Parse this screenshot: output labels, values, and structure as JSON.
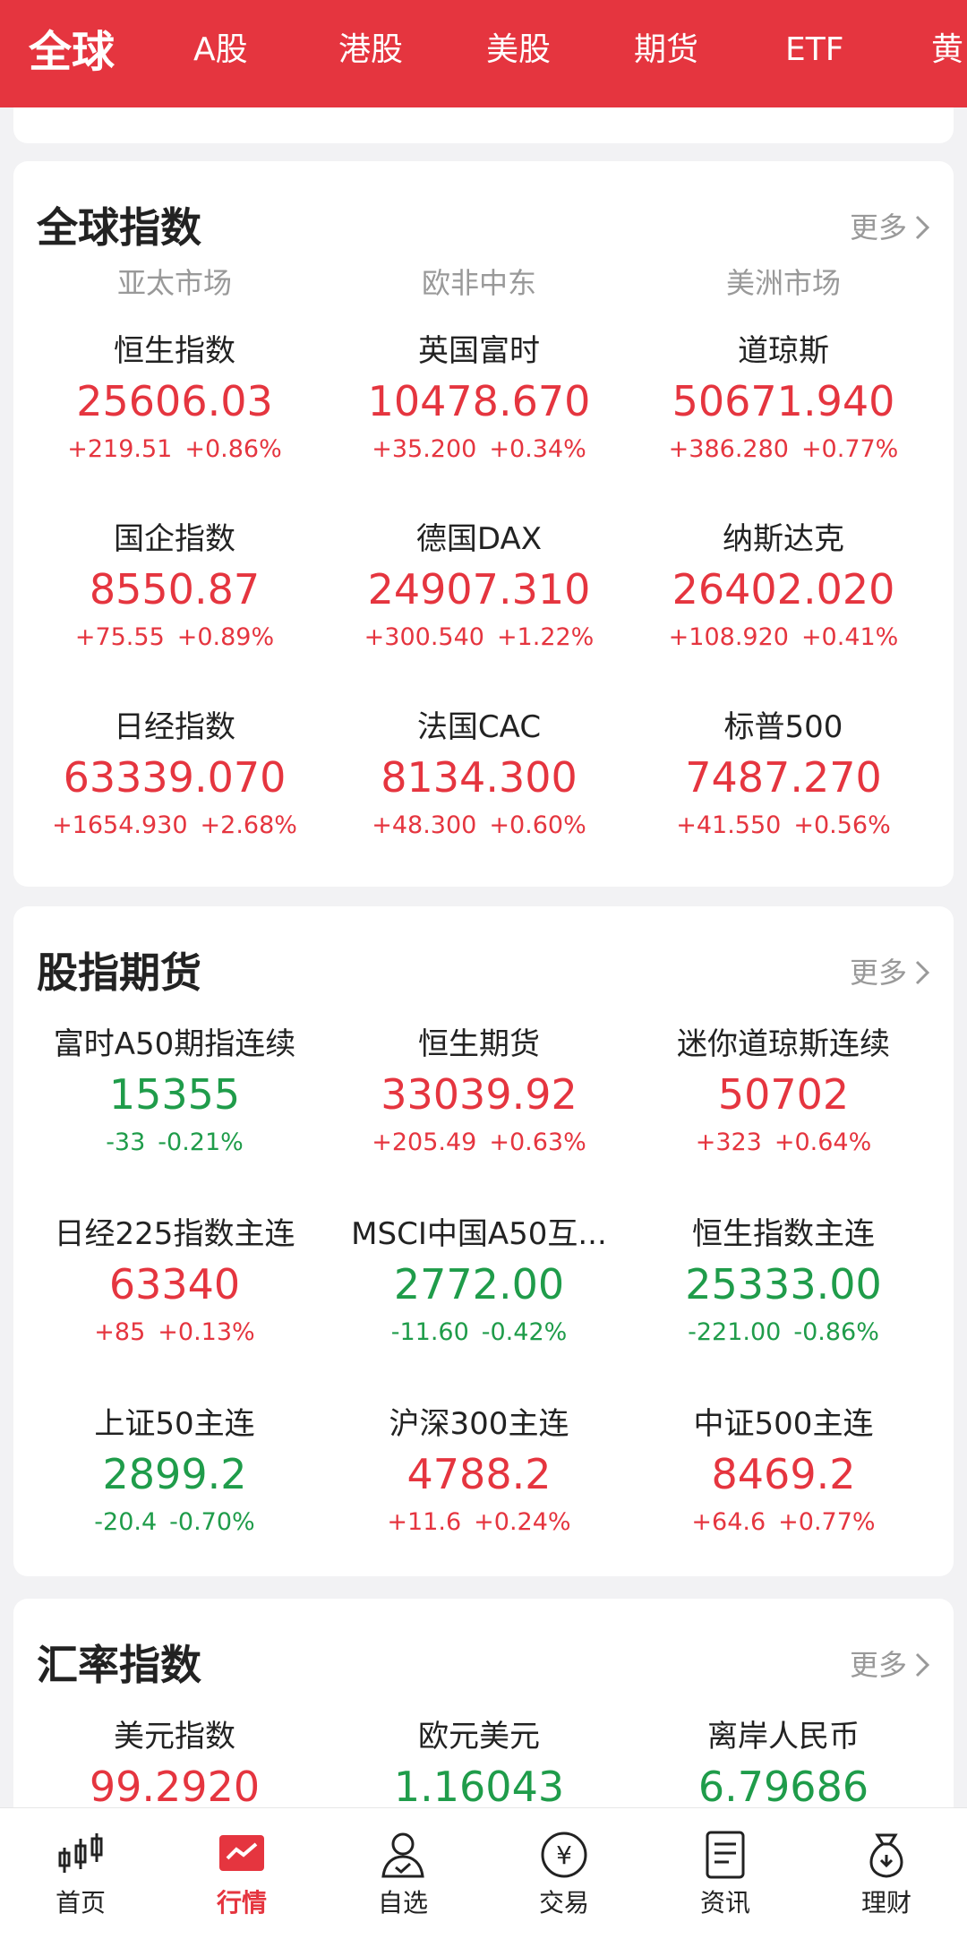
{
  "top_tabs": [
    "全球",
    "A股",
    "港股",
    "美股",
    "期货",
    "ETF",
    "黄"
  ],
  "more_label": "更多",
  "global_index": {
    "title": "全球指数",
    "regions": [
      "亚太市场",
      "欧非中东",
      "美洲市场"
    ],
    "items": [
      {
        "name": "恒生指数",
        "price": "25606.03",
        "change": "+219.51",
        "pct": "+0.86%"
      },
      {
        "name": "英国富时",
        "price": "10478.670",
        "change": "+35.200",
        "pct": "+0.34%"
      },
      {
        "name": "道琼斯",
        "price": "50671.940",
        "change": "+386.280",
        "pct": "+0.77%"
      },
      {
        "name": "国企指数",
        "price": "8550.87",
        "change": "+75.55",
        "pct": "+0.89%"
      },
      {
        "name": "德国DAX",
        "price": "24907.310",
        "change": "+300.540",
        "pct": "+1.22%"
      },
      {
        "name": "纳斯达克",
        "price": "26402.020",
        "change": "+108.920",
        "pct": "+0.41%"
      },
      {
        "name": "日经指数",
        "price": "63339.070",
        "change": "+1654.930",
        "pct": "+2.68%"
      },
      {
        "name": "法国CAC",
        "price": "8134.300",
        "change": "+48.300",
        "pct": "+0.60%"
      },
      {
        "name": "标普500",
        "price": "7487.270",
        "change": "+41.550",
        "pct": "+0.56%"
      }
    ]
  },
  "index_futures": {
    "title": "股指期货",
    "items": [
      {
        "name": "富时A50期指连续",
        "price": "15355",
        "change": "-33",
        "pct": "-0.21%"
      },
      {
        "name": "恒生期货",
        "price": "33039.92",
        "change": "+205.49",
        "pct": "+0.63%"
      },
      {
        "name": "迷你道琼斯连续",
        "price": "50702",
        "change": "+323",
        "pct": "+0.64%"
      },
      {
        "name": "日经225指数主连",
        "price": "63340",
        "change": "+85",
        "pct": "+0.13%"
      },
      {
        "name": "MSCI中国A50互...",
        "price": "2772.00",
        "change": "-11.60",
        "pct": "-0.42%"
      },
      {
        "name": "恒生指数主连",
        "price": "25333.00",
        "change": "-221.00",
        "pct": "-0.86%"
      },
      {
        "name": "上证50主连",
        "price": "2899.2",
        "change": "-20.4",
        "pct": "-0.70%"
      },
      {
        "name": "沪深300主连",
        "price": "4788.2",
        "change": "+11.6",
        "pct": "+0.24%"
      },
      {
        "name": "中证500主连",
        "price": "8469.2",
        "change": "+64.6",
        "pct": "+0.77%"
      }
    ]
  },
  "fx_index": {
    "title": "汇率指数",
    "items": [
      {
        "name": "美元指数",
        "price": "99.2920",
        "direction": "up"
      },
      {
        "name": "欧元美元",
        "price": "1.16043",
        "direction": "down"
      },
      {
        "name": "离岸人民币",
        "price": "6.79686",
        "direction": "down"
      }
    ]
  },
  "bottom_tabs": [
    {
      "label": "首页",
      "icon": "candlestick-icon"
    },
    {
      "label": "行情",
      "icon": "market-chart-icon"
    },
    {
      "label": "自选",
      "icon": "user-check-icon"
    },
    {
      "label": "交易",
      "icon": "yuan-coin-icon"
    },
    {
      "label": "资讯",
      "icon": "news-document-icon"
    },
    {
      "label": "理财",
      "icon": "money-bag-icon"
    }
  ],
  "colors": {
    "brand_red": "#e5353f",
    "up": "#e5353f",
    "down": "#1f9c4a",
    "muted": "#999999"
  }
}
